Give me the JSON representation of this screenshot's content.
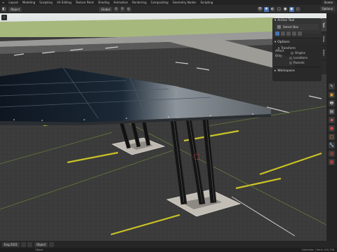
{
  "topbar": {
    "tabs": [
      {
        "label": "Layout",
        "active": false
      },
      {
        "label": "Modeling",
        "active": false
      },
      {
        "label": "Sculpting",
        "active": false
      },
      {
        "label": "UV Editing",
        "active": false
      },
      {
        "label": "Texture Paint",
        "active": false
      },
      {
        "label": "Shading",
        "active": false
      },
      {
        "label": "Animation",
        "active": false
      },
      {
        "label": "Rendering",
        "active": false
      },
      {
        "label": "Compositing",
        "active": false
      },
      {
        "label": "Geometry Nodes",
        "active": false
      },
      {
        "label": "Scripting",
        "active": false
      }
    ],
    "scene": "Scene"
  },
  "viewport_header": {
    "editor_label": "Object",
    "global_label": "Global",
    "options_label": "Options"
  },
  "npanel": {
    "active_tool_header": "Active Tool",
    "select_box": "Select Box",
    "options_header": "Options",
    "transform_header": "Transform",
    "affect_only": "Affect Only",
    "origins": "Origins",
    "locations": "Locations",
    "parents": "Parents",
    "workspace_header": "Workspace",
    "vertical_tabs": [
      "Tool",
      "View",
      "Item"
    ]
  },
  "bottombar": {
    "render_field": "Eng 2021",
    "mode_field": "Object",
    "status_left": "Object",
    "status_right": "Collection | Verts 150,798"
  },
  "colors": {
    "accent": "#4772b3",
    "asphalt": "#3a3a3a",
    "line_yellow": "#c9c226",
    "panel_bg": "#282828"
  }
}
